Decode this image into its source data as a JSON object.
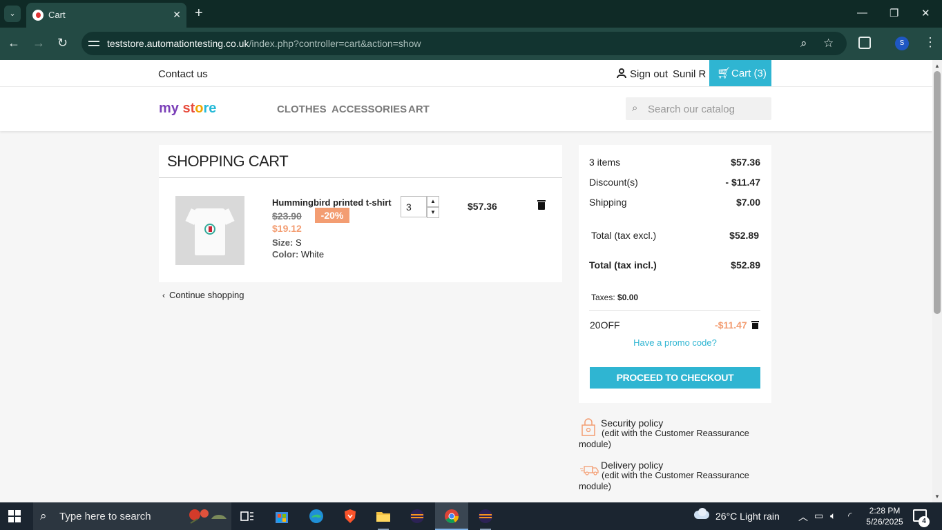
{
  "browser": {
    "tab_title": "Cart",
    "url_host": "teststore.automationtesting.co.uk",
    "url_path": "/index.php?controller=cart&action=show",
    "profile_initial": "S"
  },
  "header": {
    "contact": "Contact us",
    "sign_out": "Sign out",
    "user_name": "Sunil R",
    "cart_label": "Cart (3)",
    "logo": {
      "part1": "my",
      "part2": " ",
      "part3": "st",
      "part4": "o",
      "part5": "re"
    },
    "menu": [
      "CLOTHES",
      "ACCESSORIES",
      "ART"
    ],
    "search_placeholder": "Search our catalog"
  },
  "cart": {
    "title": "SHOPPING CART",
    "item": {
      "name": "Hummingbird printed t-shirt",
      "old_price": "$23.90",
      "discount_badge": "-20%",
      "new_price": "$19.12",
      "size_label": "Size:",
      "size_value": "S",
      "color_label": "Color:",
      "color_value": "White",
      "quantity": "3",
      "line_total": "$57.36"
    },
    "continue_shopping": "Continue shopping"
  },
  "summary": {
    "items_label": "3 items",
    "items_value": "$57.36",
    "discount_label": "Discount(s)",
    "discount_value": "- $11.47",
    "shipping_label": "Shipping",
    "shipping_value": "$7.00",
    "total_excl_label": "Total (tax excl.)",
    "total_excl_value": "$52.89",
    "total_incl_label": "Total (tax incl.)",
    "total_incl_value": "$52.89",
    "taxes_label": "Taxes:",
    "taxes_value": "$0.00",
    "voucher_code": "20OFF",
    "voucher_amount": "-$11.47",
    "promo_link": "Have a promo code?",
    "checkout_button": "PROCEED TO CHECKOUT"
  },
  "reassurance": [
    {
      "title": "Security policy",
      "desc": "(edit with the Customer Reassurance module)"
    },
    {
      "title": "Delivery policy",
      "desc": "(edit with the Customer Reassurance module)"
    }
  ],
  "taskbar": {
    "search_text": "Type here to search",
    "weather": "26°C  Light rain",
    "time": "2:28 PM",
    "date": "5/26/2025",
    "notifications": "4"
  },
  "colors": {
    "accent": "#2fb5d2",
    "discount": "#f39d72",
    "chrome_dark": "#0f2a26",
    "chrome_toolbar": "#234a44"
  }
}
